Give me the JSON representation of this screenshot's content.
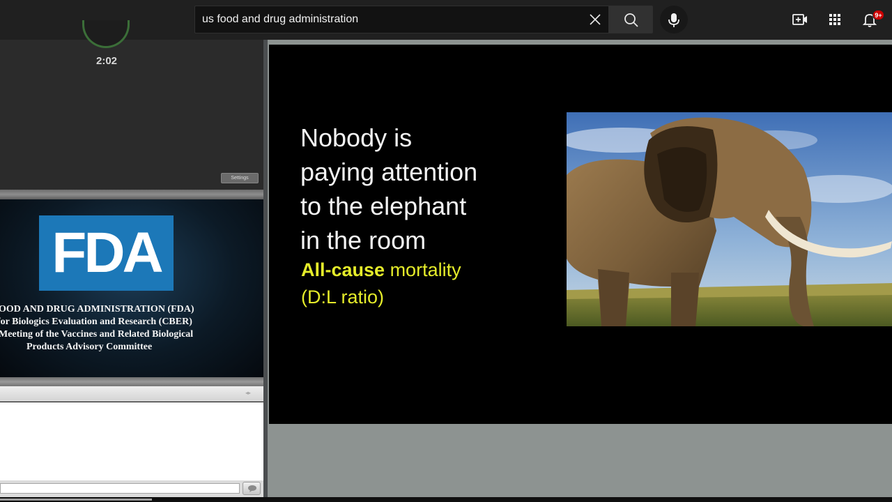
{
  "search": {
    "query": "us food and drug administration"
  },
  "header": {
    "notification_count": "9+"
  },
  "left_panel": {
    "timer": "2:02",
    "fda_logo": "FDA",
    "fda_lines": [
      "OOD AND DRUG ADMINISTRATION (FDA)",
      "for Biologics Evaluation and Research (CBER)",
      "Meeting of the Vaccines and Related Biological",
      "Products Advisory Committee"
    ]
  },
  "slide": {
    "title_lines": [
      "Nobody is",
      "paying  attention",
      "to the elephant",
      "in  the room"
    ],
    "subtitle_bold": "All-cause",
    "subtitle_rest": " mortality",
    "subtitle_line2": "(D:L ratio)"
  },
  "progress": {
    "played_fraction": 0.17
  },
  "colors": {
    "topbar_bg": "#202020",
    "fda_blue": "#1c78b8",
    "slide_subtitle": "#e5ec2a",
    "notification_badge": "#cc0000"
  },
  "icons": [
    "clear-icon",
    "search-icon",
    "mic-icon",
    "create-video-icon",
    "apps-grid-icon",
    "bell-icon",
    "send-icon"
  ]
}
